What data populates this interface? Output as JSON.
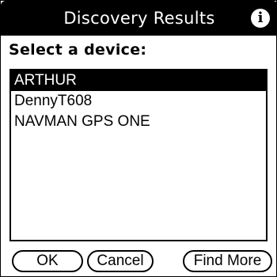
{
  "window": {
    "title": "Discovery Results",
    "info_icon": "info-icon",
    "info_glyph": "i"
  },
  "prompt": "Select a device:",
  "devices": [
    {
      "label": "ARTHUR",
      "selected": true
    },
    {
      "label": "DennyT608",
      "selected": false
    },
    {
      "label": "NAVMAN GPS ONE",
      "selected": false
    }
  ],
  "buttons": {
    "ok": "OK",
    "cancel": "Cancel",
    "find_more": "Find More"
  },
  "colors": {
    "title_bar": "#000000",
    "selection": "#000000",
    "background": "#ffffff"
  }
}
